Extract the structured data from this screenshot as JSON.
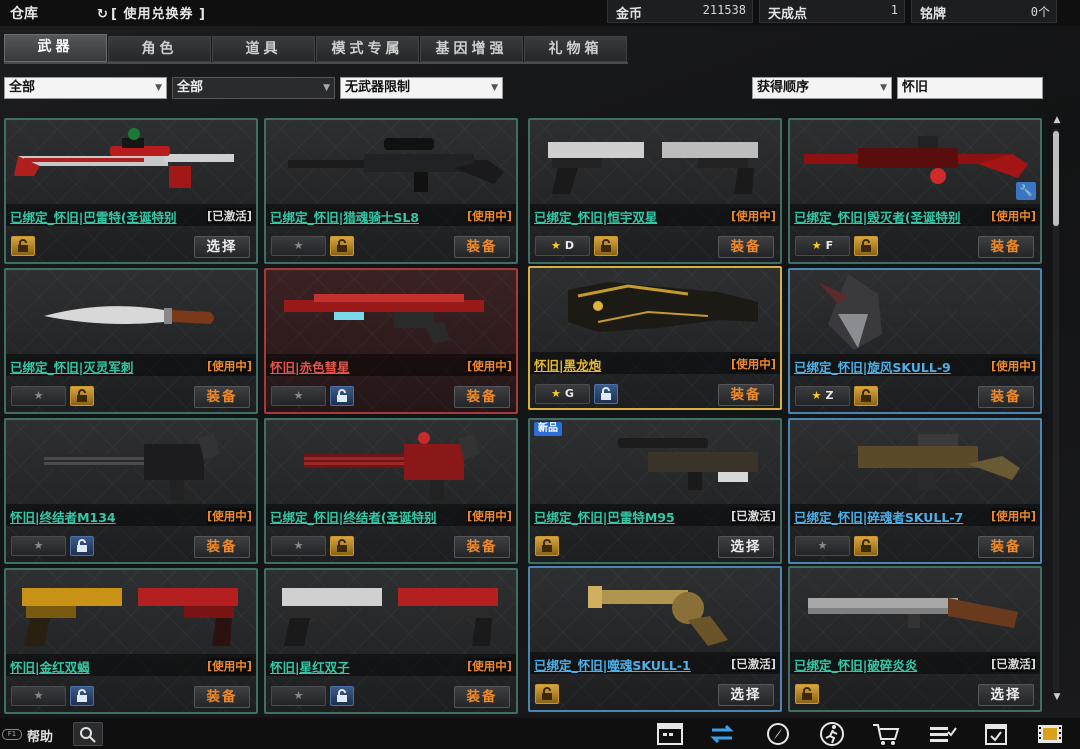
{
  "header": {
    "title": "仓库",
    "coupon_label": "[ 使用兑换券 ]",
    "currencies": [
      {
        "label": "金币",
        "value": "211538"
      },
      {
        "label": "天成点",
        "value": "1"
      },
      {
        "label": "铭牌",
        "value": "0个"
      }
    ]
  },
  "tabs": [
    {
      "label": "武器",
      "active": true
    },
    {
      "label": "角色"
    },
    {
      "label": "道具"
    },
    {
      "label": "模式专属"
    },
    {
      "label": "基因增强"
    },
    {
      "label": "礼物箱"
    }
  ],
  "filters": {
    "type": "全部",
    "sub": "全部",
    "limit": "无武器限制",
    "sort": "获得顺序",
    "search_value": "怀旧"
  },
  "items": [
    {
      "name": "已绑定_怀旧|巴雷特(圣诞特别",
      "status": "[已激活]",
      "rank": "",
      "action": "选择",
      "lock": "gold"
    },
    {
      "name": "已绑定_怀旧|猎魂骑士SL8",
      "status": "[使用中]",
      "rank": "",
      "action": "装备",
      "lock": "gold"
    },
    {
      "name": "已绑定_怀旧|恒宇双星",
      "status": "[使用中]",
      "rank": "D",
      "action": "装备",
      "lock": "gold"
    },
    {
      "name": "已绑定_怀旧|毁灭者(圣诞特别",
      "status": "[使用中]",
      "rank": "F",
      "action": "装备",
      "lock": "gold"
    },
    {
      "name": "已绑定_怀旧|灭灵军刺",
      "status": "[使用中]",
      "rank": "",
      "action": "装备",
      "lock": "gold"
    },
    {
      "name": "怀旧|赤色彗星",
      "status": "[使用中]",
      "rank": "",
      "action": "装备",
      "lock": "blue"
    },
    {
      "name": "怀旧|黑龙炮",
      "status": "[使用中]",
      "rank": "G",
      "action": "装备",
      "lock": "blue"
    },
    {
      "name": "已绑定_怀旧|旋风SKULL-9",
      "status": "[使用中]",
      "rank": "Z",
      "action": "装备",
      "lock": "gold"
    },
    {
      "name": "怀旧|终结者M134",
      "status": "[使用中]",
      "rank": "",
      "action": "装备",
      "lock": "blue"
    },
    {
      "name": "已绑定_怀旧|终结者(圣诞特别",
      "status": "[使用中]",
      "rank": "",
      "action": "装备",
      "lock": "gold"
    },
    {
      "name": "已绑定_怀旧|巴雷特M95",
      "status": "[已激活]",
      "rank": "",
      "action": "选择",
      "lock": "gold",
      "badge": "新品"
    },
    {
      "name": "已绑定_怀旧|碎魂者SKULL-7",
      "status": "[使用中]",
      "rank": "",
      "action": "装备",
      "lock": "gold"
    },
    {
      "name": "怀旧|金红双蝎",
      "status": "[使用中]",
      "rank": "",
      "action": "装备",
      "lock": "blue"
    },
    {
      "name": "怀旧|星红双子",
      "status": "[使用中]",
      "rank": "",
      "action": "装备",
      "lock": "blue"
    },
    {
      "name": "已绑定_怀旧|噬魂SKULL-1",
      "status": "[已激活]",
      "rank": "",
      "action": "选择",
      "lock": "gold"
    },
    {
      "name": "已绑定_怀旧|破碎炎炎",
      "status": "[已激活]",
      "rank": "",
      "action": "选择",
      "lock": "gold"
    }
  ],
  "footer": {
    "help_key": "F1",
    "help_label": "帮助",
    "tools": [
      "calendar-icon",
      "refresh-icon",
      "compass-icon",
      "runner-icon",
      "shop-cart-icon",
      "checklist-icon",
      "schedule-icon",
      "film-icon"
    ]
  },
  "colors": {
    "equip_orange": "#ef8a2a",
    "name_green": "#33c9a6",
    "name_red": "#e0564a",
    "name_gold": "#e6b830",
    "name_blue": "#4eb0e8",
    "border_green": "#3f6e64",
    "border_red": "#a63a3a",
    "border_gold": "#d6b13c",
    "border_blue": "#4b86b0"
  }
}
